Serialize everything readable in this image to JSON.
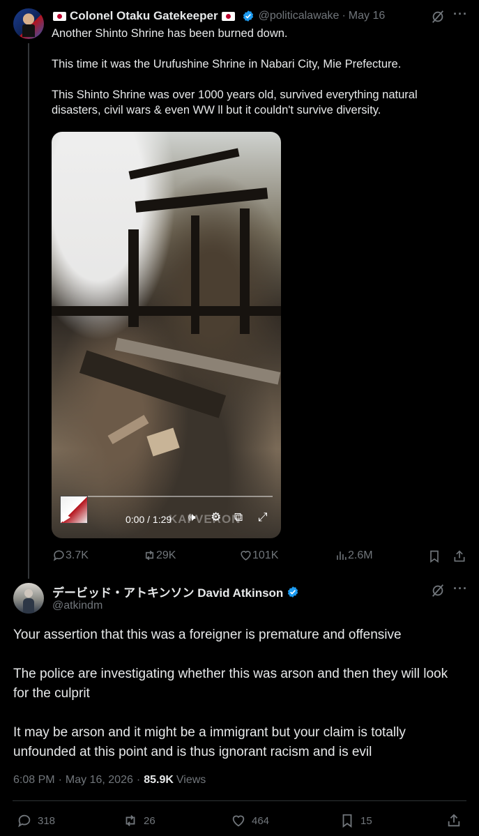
{
  "tweet1": {
    "display_name": "Colonel Otaku Gatekeeper",
    "handle": "@politicalawake",
    "separator": "·",
    "date": "May 16",
    "text": "Another Shinto Shrine has been burned down.\n\nThis time it was the Urufushine Shrine in Nabari City, Mie Prefecture.\n\nThis Shinto Shrine was over 1000 years old, survived everything natural disasters, civil wars & even WW ll but it couldn't survive diversity.",
    "video": {
      "time": "0:00 / 1:29",
      "watermark": "KAI VERON",
      "progress": 0
    },
    "replies": "3.7K",
    "reposts": "29K",
    "likes": "101K",
    "views": "2.6M"
  },
  "tweet2": {
    "display_name": "デービッド・アトキンソン David Atkinson",
    "handle": "@atkindm",
    "text": "Your assertion that this was a foreigner is premature and offensive\n\nThe police are investigating whether this was arson and then they will look for the culprit\n\nIt may be arson and it might be a immigrant but your claim is totally unfounded at this point and is thus ignorant racism and is evil",
    "time": "6:08 PM",
    "separator": "·",
    "date": "May 16, 2026",
    "views_count": "85.9K",
    "views_label": "Views",
    "replies": "318",
    "reposts": "26",
    "likes": "464",
    "bookmarks": "15"
  },
  "icons": {
    "grok": "grok-icon",
    "more": "more-icon",
    "verified": "verified-badge-icon",
    "flag": "japan-flag-icon"
  },
  "colors": {
    "background": "#000000",
    "text": "#e7e9ea",
    "muted": "#71767b",
    "verified": "#1d9bf0"
  }
}
